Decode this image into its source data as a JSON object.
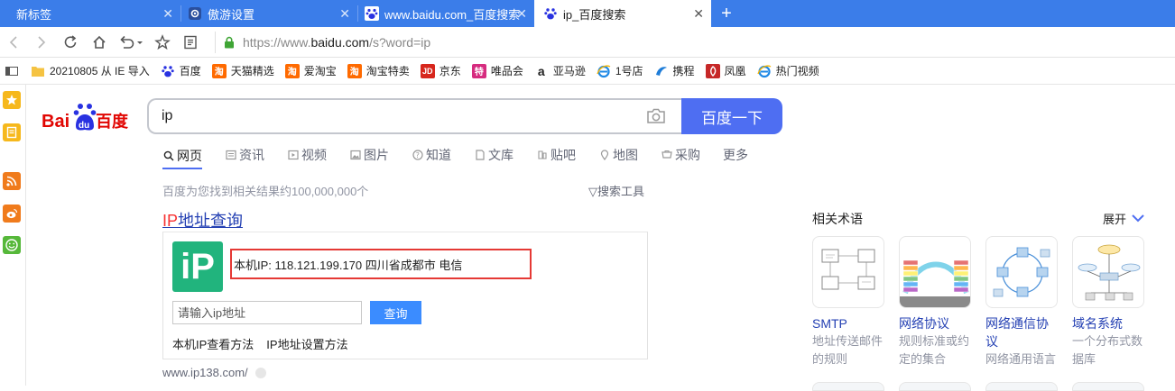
{
  "tabs": [
    {
      "label": "新标签",
      "active": false
    },
    {
      "label": "傲游设置",
      "active": false
    },
    {
      "label": "www.baidu.com_百度搜索",
      "active": false
    },
    {
      "label": "ip_百度搜索",
      "active": true
    }
  ],
  "address": {
    "prefix": "https://www.",
    "domain": "baidu.com",
    "suffix": "/s?word=ip"
  },
  "bookmarks": [
    {
      "label": "20210805 从 IE 导入",
      "icon": "folder-icon"
    },
    {
      "label": "百度",
      "icon": "baidu-paw-icon"
    },
    {
      "label": "天猫精选",
      "icon": "taobao-icon"
    },
    {
      "label": "爱淘宝",
      "icon": "taobao-icon"
    },
    {
      "label": "淘宝特卖",
      "icon": "taobao-icon"
    },
    {
      "label": "京东",
      "icon": "jd-icon"
    },
    {
      "label": "唯品会",
      "icon": "vip-icon"
    },
    {
      "label": "亚马逊",
      "icon": "amazon-icon"
    },
    {
      "label": "1号店",
      "icon": "ie-icon"
    },
    {
      "label": "携程",
      "icon": "ctrip-icon"
    },
    {
      "label": "凤凰",
      "icon": "ifeng-icon"
    },
    {
      "label": "热门视频",
      "icon": "ie-icon"
    }
  ],
  "search": {
    "query": "ip",
    "button": "百度一下"
  },
  "search_tabs": [
    {
      "label": "网页",
      "icon": "search-icon",
      "active": true
    },
    {
      "label": "资讯",
      "icon": "news-icon"
    },
    {
      "label": "视频",
      "icon": "video-icon"
    },
    {
      "label": "图片",
      "icon": "image-icon"
    },
    {
      "label": "知道",
      "icon": "question-icon"
    },
    {
      "label": "文库",
      "icon": "doc-icon"
    },
    {
      "label": "贴吧",
      "icon": "tieba-icon"
    },
    {
      "label": "地图",
      "icon": "map-icon"
    },
    {
      "label": "采购",
      "icon": "purchase-icon"
    },
    {
      "label": "更多",
      "icon": ""
    }
  ],
  "results": {
    "count_text": "百度为您找到相关结果约100,000,000个",
    "tools": "搜索工具",
    "ip_title_red": "IP",
    "ip_title_rest": "地址查询",
    "ip_logo": "iP",
    "ip_info": "本机IP: 118.121.199.170   四川省成都市 电信",
    "input_placeholder": "请输入ip地址",
    "query_button": "查询",
    "links": [
      "本机IP查看方法",
      "IP地址设置方法"
    ],
    "url": "www.ip138.com/"
  },
  "related": {
    "title": "相关术语",
    "expand": "展开",
    "items": [
      {
        "name": "SMTP",
        "desc": "地址传送邮件的规则"
      },
      {
        "name": "网络协议",
        "desc": "规则标准或约定的集合"
      },
      {
        "name": "网络通信协议",
        "desc": "网络通用语言"
      },
      {
        "name": "域名系统",
        "desc": "一个分布式数据库"
      }
    ]
  },
  "colors": {
    "tab_blue": "#3b7de9",
    "baidu_blue": "#4e6ef2",
    "link_blue": "#2440b3",
    "red": "#f73131",
    "ip_green": "#21b47d"
  }
}
